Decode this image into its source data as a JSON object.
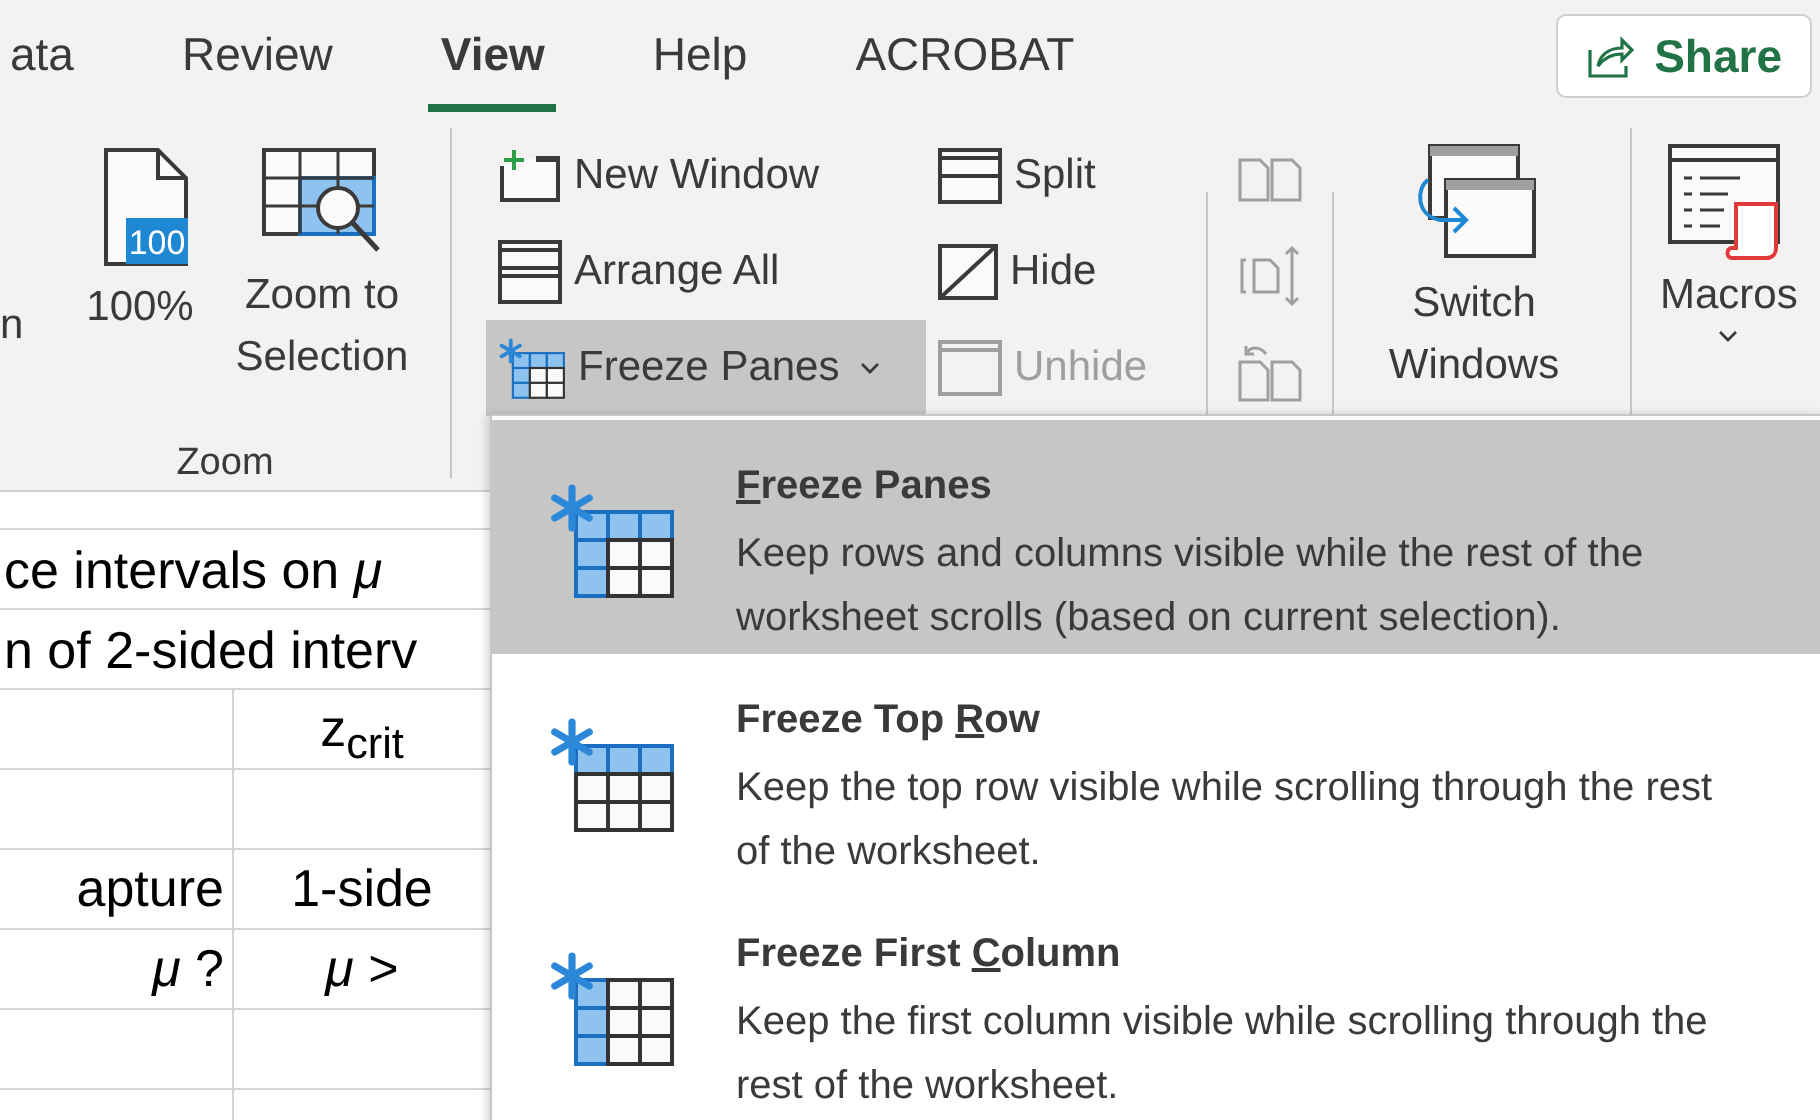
{
  "tabs": [
    {
      "label": "ata",
      "selected": false
    },
    {
      "label": "Review",
      "selected": false
    },
    {
      "label": "View",
      "selected": true
    },
    {
      "label": "Help",
      "selected": false
    },
    {
      "label": "ACROBAT",
      "selected": false
    }
  ],
  "share_button": {
    "label": "Share"
  },
  "ribbon": {
    "zoom_group": {
      "label": "Zoom",
      "buttons": [
        {
          "label": "n"
        },
        {
          "label": "100%",
          "icon_text": "100"
        },
        {
          "label": "Zoom to Selection"
        }
      ]
    },
    "window_group": {
      "column_1": [
        {
          "label": "New Window",
          "expanded": false
        },
        {
          "label": "Arrange All",
          "expanded": false
        },
        {
          "label": "Freeze Panes",
          "expanded": true
        }
      ],
      "column_2": [
        {
          "label": "Split",
          "disabled": false
        },
        {
          "label": "Hide",
          "disabled": false
        },
        {
          "label": "Unhide",
          "disabled": true
        }
      ],
      "small_buttons": [
        {
          "disabled": true
        },
        {
          "disabled": true
        },
        {
          "disabled": true
        }
      ],
      "switch_windows": {
        "label": "Switch Windows"
      }
    },
    "macros": {
      "label": "Macros"
    }
  },
  "sheet": {
    "rows": [
      {
        "kind": "merged",
        "text": "ce intervals on *μ*"
      },
      {
        "kind": "merged",
        "text": "n of 2-sided interv"
      },
      {
        "kind": "grid",
        "cells": [
          "",
          "z$_{crit}$"
        ]
      },
      {
        "kind": "grid",
        "cells": [
          "",
          ""
        ]
      },
      {
        "kind": "grid",
        "cells": [
          "apture",
          "1-side"
        ]
      },
      {
        "kind": "grid",
        "cells": [
          "*μ* ?",
          "*μ* >"
        ]
      },
      {
        "kind": "grid",
        "cells": [
          "",
          ""
        ]
      },
      {
        "kind": "grid",
        "cells": [
          "",
          ""
        ]
      }
    ]
  },
  "freeze_menu": {
    "items": [
      {
        "access_key": "F",
        "label_after": "reeze Panes",
        "description": "Keep rows and columns visible while the rest of the worksheet scrolls (based on current selection).",
        "selected": true
      },
      {
        "label_before": "Freeze Top ",
        "access_key": "R",
        "label_after": "ow",
        "description": "Keep the top row visible while scrolling through the rest of the worksheet.",
        "selected": false
      },
      {
        "label_before": "Freeze First ",
        "access_key": "C",
        "label_after": "olumn",
        "description": "Keep the first column visible while scrolling through the rest of the worksheet.",
        "selected": false
      }
    ]
  }
}
